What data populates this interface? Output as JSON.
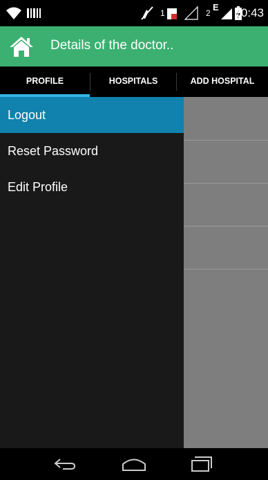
{
  "status_bar": {
    "time": "10:43",
    "network_type": "E",
    "sim1_label": "1",
    "sim2_label": "2",
    "icons": [
      "wifi-icon",
      "barcode-icon",
      "mute-icon",
      "sim1-icon",
      "no-signal-icon",
      "signal-icon",
      "battery-charging-icon"
    ]
  },
  "action_bar": {
    "title": "Details of the doctor..",
    "icon": "home-icon"
  },
  "tabs": [
    {
      "label": "PROFILE",
      "selected": true
    },
    {
      "label": "HOSPITALS",
      "selected": false
    },
    {
      "label": "ADD HOSPITAL",
      "selected": false
    }
  ],
  "drawer": {
    "items": [
      {
        "label": "Logout",
        "active": true
      },
      {
        "label": "Reset Password",
        "active": false
      },
      {
        "label": "Edit Profile",
        "active": false
      }
    ]
  },
  "nav_bar": {
    "buttons": [
      "back-icon",
      "home-outline-icon",
      "recent-apps-icon"
    ]
  },
  "colors": {
    "action_bar": "#3bb071",
    "tab_indicator": "#33b5e5",
    "drawer_active": "#1181ad",
    "drawer_bg": "#191919",
    "content_bg": "#7e7e7e"
  }
}
